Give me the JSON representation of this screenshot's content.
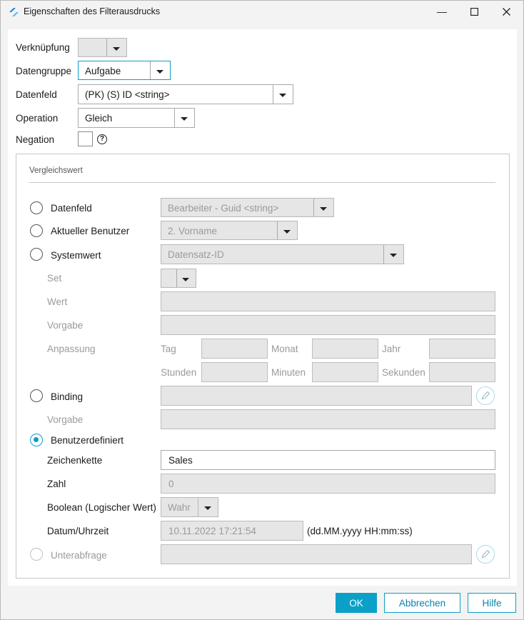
{
  "window": {
    "title": "Eigenschaften des Filterausdrucks",
    "minimize_glyph": "—",
    "maximize_glyph": "☐",
    "close_glyph": "✕"
  },
  "form": {
    "verknuepfung": {
      "label": "Verknüpfung",
      "value": ""
    },
    "datengruppe": {
      "label": "Datengruppe",
      "value": "Aufgabe"
    },
    "datenfeld": {
      "label": "Datenfeld",
      "value": "(PK) (S) ID <string>"
    },
    "operation": {
      "label": "Operation",
      "value": "Gleich"
    },
    "negation": {
      "label": "Negation",
      "help_glyph": "?"
    }
  },
  "compare": {
    "title": "Vergleichswert",
    "datenfeld": {
      "label": "Datenfeld",
      "value": "Bearbeiter - Guid <string>"
    },
    "aktueller_benutzer": {
      "label": "Aktueller Benutzer",
      "value": "2. Vorname"
    },
    "systemwert": {
      "label": "Systemwert",
      "value": "Datensatz-ID"
    },
    "set": {
      "label": "Set",
      "value": ""
    },
    "wert": {
      "label": "Wert",
      "value": ""
    },
    "vorgabe1": {
      "label": "Vorgabe",
      "value": ""
    },
    "anpassung": {
      "label": "Anpassung",
      "tag": "Tag",
      "monat": "Monat",
      "jahr": "Jahr",
      "stunden": "Stunden",
      "minuten": "Minuten",
      "sekunden": "Sekunden"
    },
    "binding": {
      "label": "Binding",
      "value": ""
    },
    "vorgabe2": {
      "label": "Vorgabe",
      "value": ""
    },
    "benutzerdefiniert": {
      "label": "Benutzerdefiniert"
    },
    "zeichenkette": {
      "label": "Zeichenkette",
      "value": "Sales"
    },
    "zahl": {
      "label": "Zahl",
      "value": "0"
    },
    "boolean": {
      "label": "Boolean (Logischer Wert)",
      "value": "Wahr"
    },
    "datum": {
      "label": "Datum/Uhrzeit",
      "value": "10.11.2022 17:21:54",
      "format": "(dd.MM.yyyy HH:mm:ss)"
    },
    "unterabfrage": {
      "label": "Unterabfrage",
      "value": ""
    }
  },
  "buttons": {
    "ok": "OK",
    "abbrechen": "Abbrechen",
    "hilfe": "Hilfe"
  },
  "colors": {
    "accent": "#0aa0c8",
    "disabled_bg": "#e6e6e6"
  }
}
